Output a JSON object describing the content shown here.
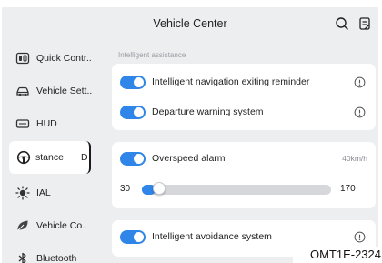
{
  "header": {
    "title": "Vehicle Center",
    "search_icon": "search-icon",
    "manual_icon": "manual-icon"
  },
  "sidebar": {
    "items": [
      {
        "label": "Quick Contr..",
        "icon": "quick-control-icon"
      },
      {
        "label": "Vehicle Sett..",
        "icon": "car-icon"
      },
      {
        "label": "HUD",
        "icon": "hud-icon"
      },
      {
        "label": "stance",
        "label_extra": "D",
        "icon": "steering-wheel-icon",
        "active": true
      },
      {
        "label": "IAL",
        "icon": "light-icon"
      },
      {
        "label": "Vehicle Co..",
        "icon": "leaf-icon"
      },
      {
        "label": "Bluetooth",
        "icon": "bluetooth-icon"
      }
    ]
  },
  "main": {
    "section_label": "Intelligent assistance",
    "card1": [
      {
        "label": "Intelligent navigation exiting reminder",
        "enabled": true
      },
      {
        "label": "Departure warning system",
        "enabled": true
      }
    ],
    "overspeed": {
      "label": "Overspeed alarm",
      "enabled": true,
      "speed": "40km/h",
      "slider_min": "30",
      "slider_max": "170",
      "slider_fraction": 0.07
    },
    "card3": [
      {
        "label": "Intelligent avoidance system",
        "enabled": true
      }
    ]
  },
  "watermark": "OMT1E-2324",
  "colors": {
    "accent": "#2f86e8",
    "background": "#edeef0",
    "card": "#ffffff",
    "muted_text": "#9a9ca2"
  }
}
